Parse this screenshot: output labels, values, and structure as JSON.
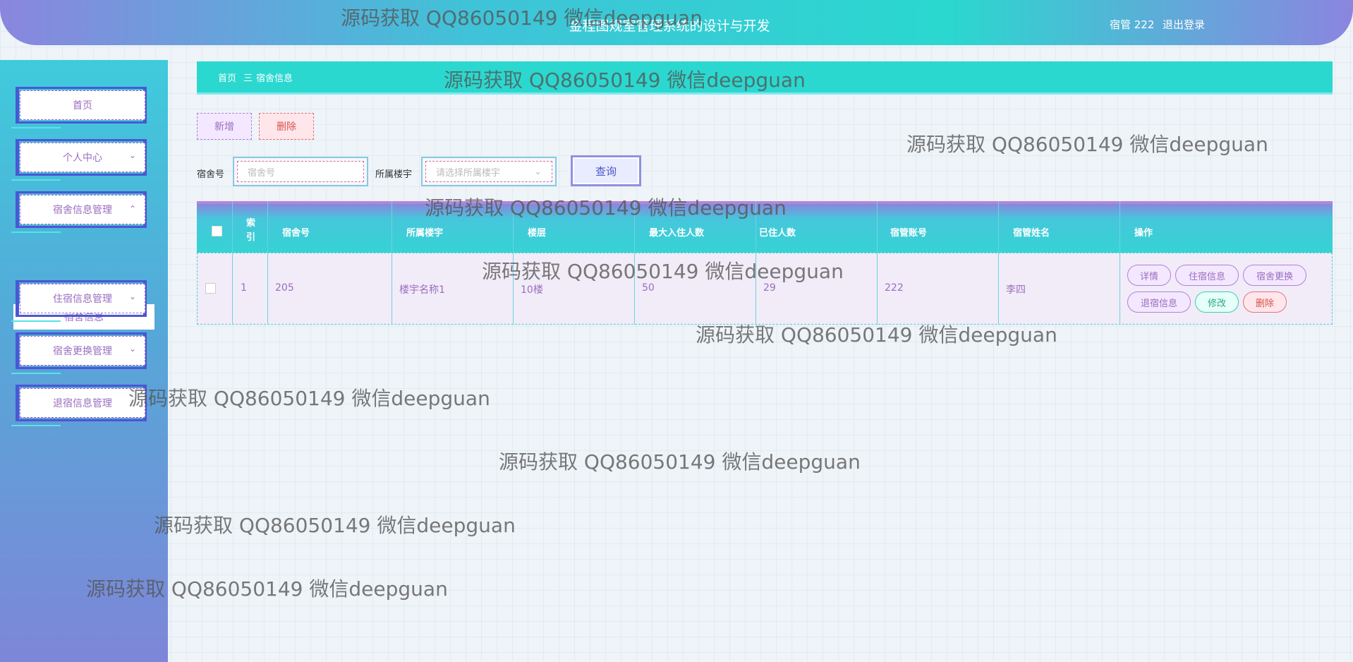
{
  "header": {
    "title": "金程图规室管理系统的设计与开发",
    "user": "宿管 222",
    "logout": "退出登录"
  },
  "sidebar": {
    "items": [
      {
        "label": "首页",
        "expanded": false
      },
      {
        "label": "个人中心",
        "expanded": false
      },
      {
        "label": "宿舍信息管理",
        "expanded": true
      },
      {
        "label": "住宿信息管理",
        "expanded": false
      },
      {
        "label": "宿舍更换管理",
        "expanded": false
      },
      {
        "label": "退宿信息管理",
        "expanded": false
      }
    ],
    "submenu_active": "宿舍信息"
  },
  "breadcrumb": {
    "home": "首页",
    "separator": "三",
    "current": "宿舍信息"
  },
  "toolbar": {
    "add_label": "新增",
    "delete_label": "删除"
  },
  "search": {
    "dorm_label": "宿舍号",
    "dorm_placeholder": "宿舍号",
    "building_label": "所属楼宇",
    "building_placeholder": "请选择所属楼宇",
    "query_label": "查询"
  },
  "table": {
    "headers": [
      "索引",
      "宿舍号",
      "所属楼宇",
      "楼层",
      "最大入住人数",
      "已住人数",
      "宿管账号",
      "宿管姓名",
      "操作"
    ],
    "rows": [
      {
        "index": "1",
        "dorm": "205",
        "building": "楼宇名称1",
        "floor": "10楼",
        "max": "50",
        "current": "29",
        "account": "222",
        "name": "李四"
      }
    ],
    "actions": [
      "详情",
      "住宿信息",
      "宿舍更换",
      "退宿信息",
      "修改",
      "删除"
    ]
  },
  "watermark": "源码获取 QQ86050149 微信deepguan",
  "colors": {
    "accent": "#2bd8cf",
    "purple": "#9b6dbf",
    "danger": "#d9534f"
  }
}
